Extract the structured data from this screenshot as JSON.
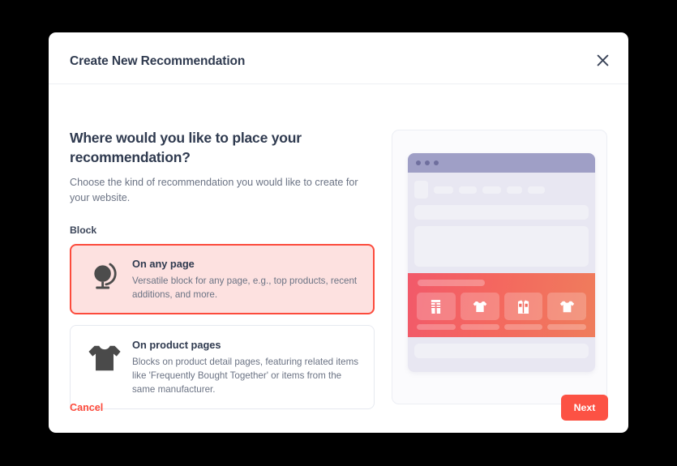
{
  "modal": {
    "title": "Create New Recommendation",
    "close_icon": "close-icon",
    "headline": "Where would you like to place your recommendation?",
    "subtext": "Choose the kind of recommendation you would like to create for your website.",
    "field_label": "Block",
    "options": [
      {
        "icon": "globe-icon",
        "title": "On any page",
        "description": "Versatile block for any page, e.g., top products, recent additions, and more.",
        "selected": true
      },
      {
        "icon": "tshirt-icon",
        "title": "On product pages",
        "description": "Blocks on product detail pages, featuring related items like 'Frequently Bought Together' or items from the same manufacturer.",
        "selected": false
      }
    ],
    "footer": {
      "cancel_label": "Cancel",
      "next_label": "Next"
    }
  },
  "preview": {
    "window_dots": 3,
    "nav_items": 5,
    "reco_items": [
      {
        "icon": "pants-icon"
      },
      {
        "icon": "tshirt-icon"
      },
      {
        "icon": "shirt-icon"
      },
      {
        "icon": "tshirt-icon"
      }
    ]
  },
  "colors": {
    "accent": "#fc4b3c",
    "accent_button": "#fc5244",
    "selected_card_bg": "#fde1e0",
    "heading": "#2f3a4f",
    "muted_text": "#6b7384",
    "browser_bar": "#9f9fc6",
    "browser_bg": "#e8e7f2",
    "gradient_start": "#f2596a",
    "gradient_end": "#ef7d5c",
    "page_bg": "#000000"
  }
}
